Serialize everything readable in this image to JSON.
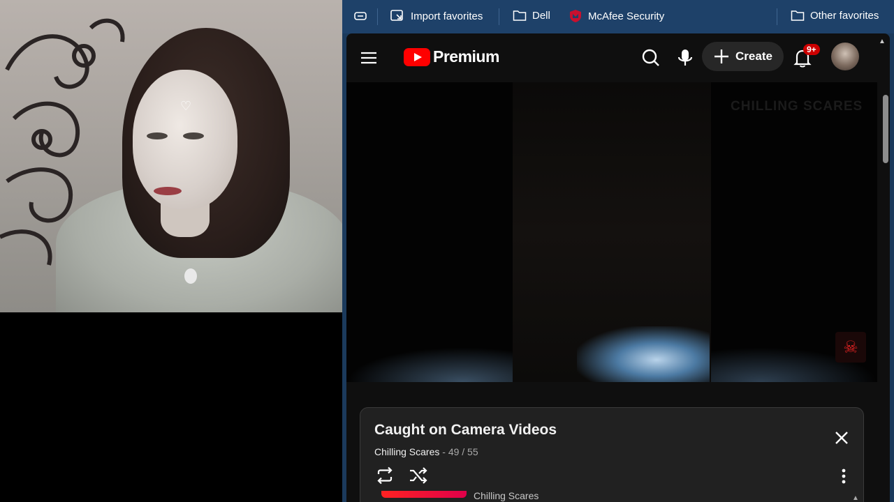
{
  "favorites_bar": {
    "import_label": "Import favorites",
    "folder_dell": "Dell",
    "mcafee_label": "McAfee Security",
    "other_label": "Other favorites"
  },
  "youtube": {
    "logo_text": "Premium",
    "create_label": "Create",
    "notification_count": "9+",
    "video": {
      "watermark": "CHILLING SCARES"
    },
    "playlist": {
      "title": "Caught on Camera Videos",
      "channel": "Chilling Scares",
      "position": " - 49 / 55",
      "next_item_channel": "Chilling Scares"
    }
  },
  "colors": {
    "favbar_bg": "#1e4169",
    "youtube_bg": "#0f0f0f",
    "brand_red": "#ff0000",
    "badge_red": "#cc0000"
  },
  "icons": [
    "collections-icon",
    "import-favorites-icon",
    "folder-icon",
    "mcafee-shield-icon",
    "menu-icon",
    "search-icon",
    "microphone-icon",
    "plus-icon",
    "bell-icon",
    "loop-icon",
    "shuffle-icon",
    "close-icon",
    "more-vertical-icon"
  ]
}
